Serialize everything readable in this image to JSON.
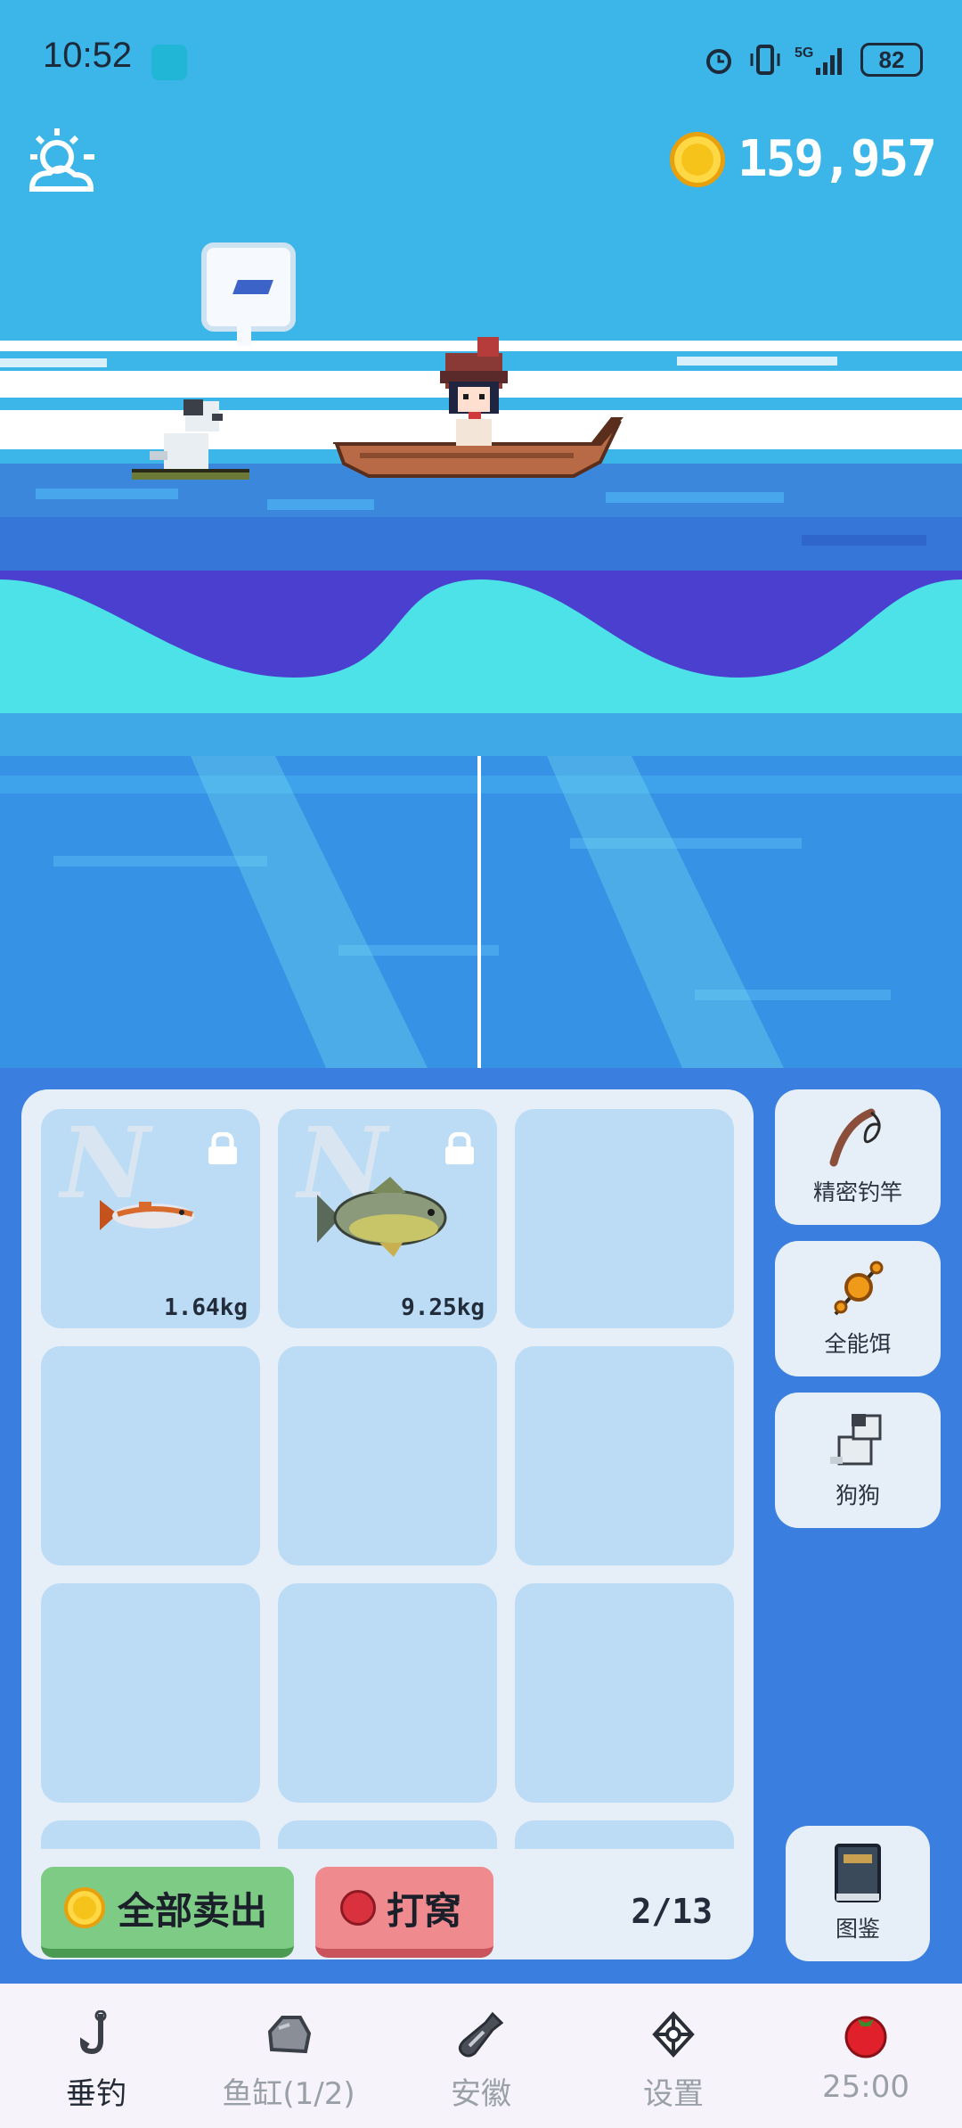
{
  "status_bar": {
    "time": "10:52",
    "battery": "82",
    "icons": [
      "alarm-icon",
      "vibrate-icon",
      "5g-icon",
      "signal-icon",
      "battery-icon"
    ]
  },
  "hud": {
    "weather_icon": "sun-cloud-icon",
    "coin_count": "159,957"
  },
  "inventory": {
    "slots": [
      {
        "weight": "1.64kg",
        "fish": "small-orange-fish",
        "locked": true
      },
      {
        "weight": "9.25kg",
        "fish": "large-green-fish",
        "locked": true
      },
      {
        "weight": "",
        "fish": "",
        "locked": false
      }
    ],
    "sell_all_label": "全部卖出",
    "bait_label": "打窝",
    "capacity": "2/13"
  },
  "side_items": [
    {
      "label": "精密钓竿",
      "icon": "fishing-rod-icon"
    },
    {
      "label": "全能饵",
      "icon": "bait-icon"
    },
    {
      "label": "狗狗",
      "icon": "dog-icon"
    },
    {
      "label": "图鉴",
      "icon": "book-icon"
    }
  ],
  "nav": {
    "items": [
      {
        "label": "垂钓",
        "icon": "hook-icon",
        "active": true
      },
      {
        "label": "鱼缸(1/2)",
        "icon": "rock-icon",
        "active": false
      },
      {
        "label": "安徽",
        "icon": "bottle-icon",
        "active": false
      },
      {
        "label": "设置",
        "icon": "settings-icon",
        "active": false
      },
      {
        "label": "25:00",
        "icon": "tomato-icon",
        "active": false
      }
    ]
  },
  "colors": {
    "sky": "#3cb5e8",
    "sea_deep": "#3592e4",
    "wave_purple": "#4a3fcf",
    "wave_cyan": "#4ce2e8",
    "panel_blue": "#3a7fe0",
    "slot": "#bcdcf5",
    "sell_green": "#7dcb84",
    "bait_red": "#ef8a8f"
  }
}
